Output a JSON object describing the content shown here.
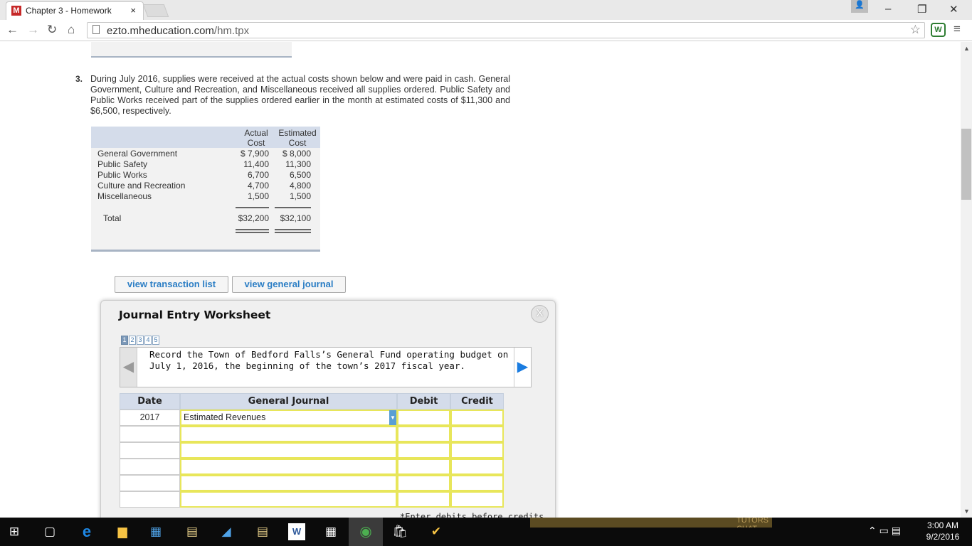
{
  "browser": {
    "tab_title": "Chapter 3 - Homework",
    "tab_logo": "M",
    "tab_close": "×",
    "url_domain": "ezto.mheducation.com",
    "url_path": "/hm.tpx",
    "window_controls": {
      "minimize": "–",
      "restore": "❐",
      "close": "✕"
    }
  },
  "question": {
    "number": "3.",
    "text": "During July 2016, supplies were received at the actual costs shown below and were paid in cash. General Government, Culture and Recreation, and Miscellaneous received all supplies ordered. Public Safety and Public Works received part of the supplies ordered earlier in the month at estimated costs of $11,300 and $6,500, respectively."
  },
  "cost_table": {
    "headers": {
      "actual_line1": "Actual",
      "actual_line2": "Cost",
      "estimated_line1": "Estimated",
      "estimated_line2": "Cost"
    },
    "rows": [
      {
        "label": "General Government",
        "actual": "$ 7,900",
        "estimated": "$ 8,000"
      },
      {
        "label": "Public Safety",
        "actual": "11,400",
        "estimated": "11,300"
      },
      {
        "label": "Public Works",
        "actual": "6,700",
        "estimated": "6,500"
      },
      {
        "label": "Culture and Recreation",
        "actual": "4,700",
        "estimated": "4,800"
      },
      {
        "label": "Miscellaneous",
        "actual": "1,500",
        "estimated": "1,500"
      }
    ],
    "total": {
      "label": "Total",
      "actual": "$32,200",
      "estimated": "$32,100"
    }
  },
  "buttons": {
    "transaction_list": "view transaction list",
    "general_journal": "view general journal"
  },
  "worksheet": {
    "title": "Journal Entry Worksheet",
    "close": "X",
    "steps": [
      "1",
      "2",
      "3",
      "4",
      "5"
    ],
    "active_step": 1,
    "prompt": "Record the Town of Bedford Falls’s General Fund operating budget on July 1, 2016, the beginning of the town’s 2017 fiscal year.",
    "prev_arrow": "◀",
    "next_arrow": "▶",
    "columns": {
      "date": "Date",
      "journal": "General Journal",
      "debit": "Debit",
      "credit": "Credit"
    },
    "rows": [
      {
        "date": "2017",
        "account": "Estimated Revenues",
        "debit": "",
        "credit": ""
      },
      {
        "date": "",
        "account": "",
        "debit": "",
        "credit": ""
      },
      {
        "date": "",
        "account": "",
        "debit": "",
        "credit": ""
      },
      {
        "date": "",
        "account": "",
        "debit": "",
        "credit": ""
      },
      {
        "date": "",
        "account": "",
        "debit": "",
        "credit": ""
      },
      {
        "date": "",
        "account": "",
        "debit": "",
        "credit": ""
      }
    ],
    "note": "*Enter debits before credits"
  },
  "background_ad": {
    "text": "TUTORS CHAT"
  },
  "taskbar": {
    "time": "3:00 AM",
    "date": "9/2/2016"
  },
  "icons": [
    "windows-start-icon",
    "task-view-icon",
    "edge-icon",
    "file-explorer-icon",
    "control-panel-icon",
    "folder-icon",
    "network-icon",
    "files-icon",
    "word-icon",
    "calculator-icon",
    "chrome-icon",
    "store-icon",
    "norton-icon"
  ]
}
